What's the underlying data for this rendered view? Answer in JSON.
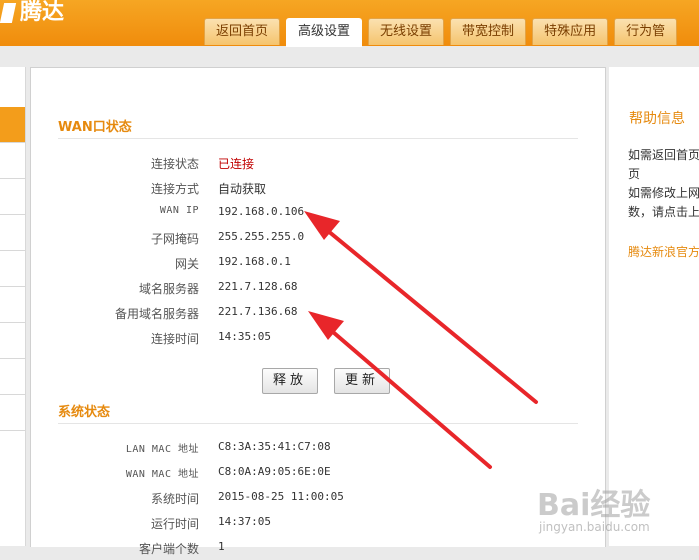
{
  "header": {
    "logo_text": "腾达",
    "nav": [
      {
        "label": "返回首页",
        "active": false
      },
      {
        "label": "高级设置",
        "active": true
      },
      {
        "label": "无线设置",
        "active": false
      },
      {
        "label": "带宽控制",
        "active": false
      },
      {
        "label": "特殊应用",
        "active": false
      },
      {
        "label": "行为管",
        "active": false
      }
    ]
  },
  "wan": {
    "title": "WAN口状态",
    "rows": [
      {
        "label": "连接状态",
        "value": "已连接"
      },
      {
        "label": "连接方式",
        "value": "自动获取"
      },
      {
        "label": "WAN IP",
        "value": "192.168.0.106"
      },
      {
        "label": "子网掩码",
        "value": "255.255.255.0"
      },
      {
        "label": "网关",
        "value": "192.168.0.1"
      },
      {
        "label": "域名服务器",
        "value": "221.7.128.68"
      },
      {
        "label": "备用域名服务器",
        "value": "221.7.136.68"
      },
      {
        "label": "连接时间",
        "value": "14:35:05"
      }
    ],
    "release_button": "释放",
    "renew_button": "更新"
  },
  "system": {
    "title": "系统状态",
    "rows": [
      {
        "label": "LAN MAC 地址",
        "value": "C8:3A:35:41:C7:08"
      },
      {
        "label": "WAN MAC 地址",
        "value": "C8:0A:A9:05:6E:0E"
      },
      {
        "label": "系统时间",
        "value": "2015-08-25 11:00:05"
      },
      {
        "label": "运行时间",
        "value": "14:37:05"
      },
      {
        "label": "客户端个数",
        "value": "1"
      }
    ]
  },
  "help": {
    "title": "帮助信息",
    "text": "如需返回首页\n页\n如需修改上网\n数，请点击上",
    "link": "腾达新浪官方"
  },
  "watermark": {
    "main": "Bai经验",
    "sub": "jingyan.baidu.com"
  },
  "colors": {
    "header_orange": "#f39d1b",
    "title_orange": "#e68a0f",
    "connected_red": "#c00000",
    "arrow_red": "#e8262a"
  }
}
